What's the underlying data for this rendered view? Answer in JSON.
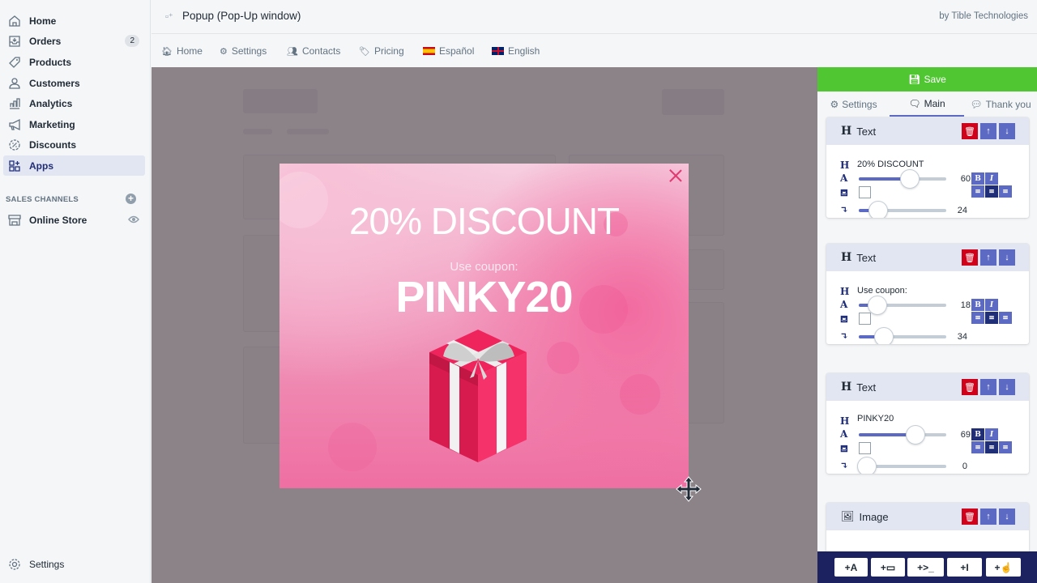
{
  "sidebar": {
    "items": [
      {
        "label": "Home",
        "icon": "home-icon"
      },
      {
        "label": "Orders",
        "icon": "orders-icon",
        "badge": "2"
      },
      {
        "label": "Products",
        "icon": "tag-icon"
      },
      {
        "label": "Customers",
        "icon": "person-icon"
      },
      {
        "label": "Analytics",
        "icon": "bar-chart-icon"
      },
      {
        "label": "Marketing",
        "icon": "megaphone-icon"
      },
      {
        "label": "Discounts",
        "icon": "discount-icon"
      },
      {
        "label": "Apps",
        "icon": "apps-icon",
        "active": true
      }
    ],
    "sales_channels_title": "SALES CHANNELS",
    "online_store": "Online Store",
    "settings": "Settings"
  },
  "header": {
    "title": "Popup (Pop-Up window)",
    "byline": "by Tible Technologies"
  },
  "subnav": [
    {
      "label": "Home",
      "icon": "home-icon"
    },
    {
      "label": "Settings",
      "icon": "gear-icon"
    },
    {
      "label": "Contacts",
      "icon": "users-icon"
    },
    {
      "label": "Pricing",
      "icon": "tags-icon"
    },
    {
      "label": "Español",
      "icon": "flag-es-icon"
    },
    {
      "label": "English",
      "icon": "flag-uk-icon"
    }
  ],
  "popup": {
    "headline": "20% DISCOUNT",
    "subline": "Use coupon:",
    "code": "PINKY20",
    "colors": {
      "pink": "#ef6fa2",
      "gift": "#f0245c"
    }
  },
  "panel": {
    "save_label": "Save",
    "tabs": [
      {
        "label": "Settings",
        "active": false
      },
      {
        "label": "Main",
        "active": true
      },
      {
        "label": "Thank you",
        "active": false
      }
    ],
    "blocks": [
      {
        "type": "Text",
        "text": "20% DISCOUNT",
        "size": 60,
        "size_pct": 0.58,
        "margin": 24,
        "margin_pct": 0.22,
        "bold": false,
        "italic": false,
        "align": "center"
      },
      {
        "type": "Text",
        "text": "Use coupon:",
        "size": 18,
        "size_pct": 0.21,
        "margin": 34,
        "margin_pct": 0.29,
        "bold": false,
        "italic": false,
        "align": "center"
      },
      {
        "type": "Text",
        "text": "PINKY20",
        "size": 69,
        "size_pct": 0.65,
        "margin": 0,
        "margin_pct": 0.09,
        "bold": true,
        "italic": false,
        "align": "center"
      }
    ],
    "image_block_label": "Image",
    "add_buttons": [
      "+A",
      "+▭",
      "+>_",
      "+I",
      "+☝"
    ]
  },
  "colors": {
    "save_green": "#50c732",
    "accent": "#5c6ac4",
    "delete_red": "#d0021b",
    "dark_navy": "#1c2260"
  }
}
